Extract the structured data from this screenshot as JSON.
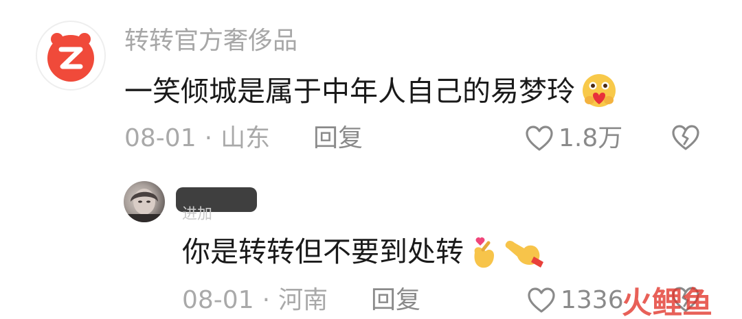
{
  "comment": {
    "username": "转转官方奢侈品",
    "text": "一笑倾城是属于中年人自己的易梦玲",
    "date": "08-01",
    "separator": "·",
    "location": "山东",
    "reply_label": "回复",
    "like_count": "1.8万",
    "avatar_icon": "zhuanzhuan-logo-icon",
    "emoji_icon": "heart-hug-emoji"
  },
  "reply": {
    "username_redacted": true,
    "username_visible_tail": "进加",
    "text": "你是转转但不要到处转",
    "date": "08-01",
    "separator": "·",
    "location": "河南",
    "reply_label": "回复",
    "like_count": "1336",
    "emoji_icons": [
      "finger-heart-emoji",
      "pointing-hand-emoji"
    ]
  },
  "watermark": {
    "text": "火鲤鱼"
  },
  "colors": {
    "brand_red": "#f04a3a",
    "meta_gray": "#a9a9a9",
    "text_dark": "#1a1a1a"
  }
}
